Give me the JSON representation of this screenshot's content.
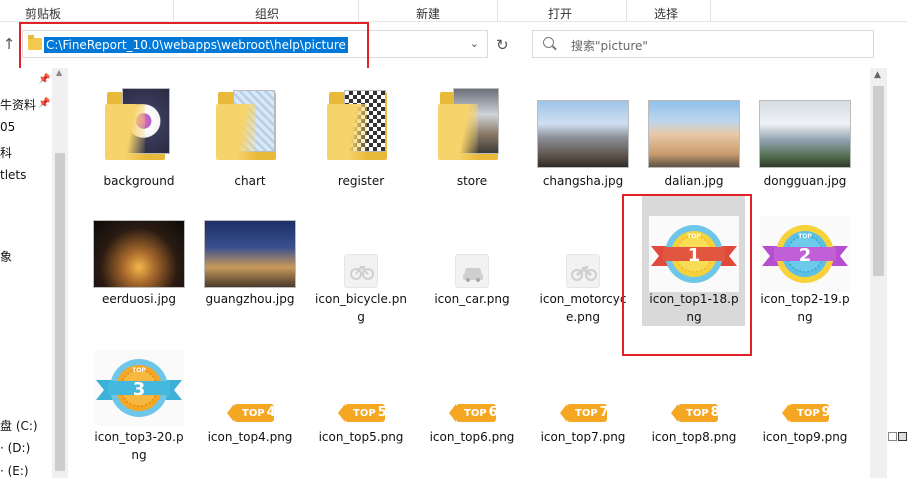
{
  "ribbon": {
    "groups": [
      "剪贴板",
      "组织",
      "新建",
      "打开",
      "选择"
    ]
  },
  "address": {
    "path": "C:\\FineReport_10.0\\webapps\\webroot\\help\\picture",
    "search_placeholder": "搜索\"picture\""
  },
  "sidebar": {
    "items": [
      "牛资料",
      "05",
      "科",
      "tlets",
      "象",
      "盘 (C:)",
      "· (D:)",
      "· (E:)"
    ]
  },
  "files": [
    {
      "name": "background",
      "type": "folder"
    },
    {
      "name": "chart",
      "type": "folder"
    },
    {
      "name": "register",
      "type": "folder"
    },
    {
      "name": "store",
      "type": "folder"
    },
    {
      "name": "changsha.jpg",
      "type": "photo"
    },
    {
      "name": "dalian.jpg",
      "type": "photo"
    },
    {
      "name": "dongguan.jpg",
      "type": "photo"
    },
    {
      "name": "eerduosi.jpg",
      "type": "photo"
    },
    {
      "name": "guangzhou.jpg",
      "type": "photo"
    },
    {
      "name": "icon_bicycle.png",
      "type": "icon"
    },
    {
      "name": "icon_car.png",
      "type": "icon"
    },
    {
      "name": "icon_motorcycle.png",
      "type": "icon"
    },
    {
      "name": "icon_top1-18.png",
      "type": "medal",
      "selected": true
    },
    {
      "name": "icon_top2-19.png",
      "type": "medal"
    },
    {
      "name": "icon_top3-20.png",
      "type": "medal"
    },
    {
      "name": "icon_top4.png",
      "type": "tag"
    },
    {
      "name": "icon_top5.png",
      "type": "tag"
    },
    {
      "name": "icon_top6.png",
      "type": "tag"
    },
    {
      "name": "icon_top7.png",
      "type": "tag"
    },
    {
      "name": "icon_top8.png",
      "type": "tag"
    },
    {
      "name": "icon_top9.png",
      "type": "tag"
    }
  ],
  "labels": {
    "f0": "background",
    "f1": "chart",
    "f2": "register",
    "f3": "store",
    "p0": "changsha.jpg",
    "p1": "dalian.jpg",
    "p2": "dongguan.jpg",
    "p3": "eerduosi.jpg",
    "p4": "guangzhou.jpg",
    "i0a": "icon_bicycle.pn",
    "i0b": "g",
    "i1": "icon_car.png",
    "i2a": "icon_motorcyc",
    "i2b": "e.png",
    "m1a": "icon_top1-18.p",
    "m1b": "ng",
    "m2a": "icon_top2-19.p",
    "m2b": "ng",
    "m3a": "icon_top3-20.p",
    "m3b": "ng",
    "t4": "icon_top4.png",
    "t5": "icon_top5.png",
    "t6": "icon_top6.png",
    "t7": "icon_top7.png",
    "t8": "icon_top8.png",
    "t9": "icon_top9.png"
  },
  "medal_text": {
    "top": "TOP",
    "n1": "1",
    "n2": "2",
    "n3": "3"
  },
  "tag_text": {
    "top": "TOP",
    "n4": "4",
    "n5": "5",
    "n6": "6",
    "n7": "7",
    "n8": "8",
    "n9": "9"
  },
  "colors": {
    "highlight": "#0078d7",
    "annotation_red": "#e2202a",
    "selection": "#d9d9d9"
  }
}
